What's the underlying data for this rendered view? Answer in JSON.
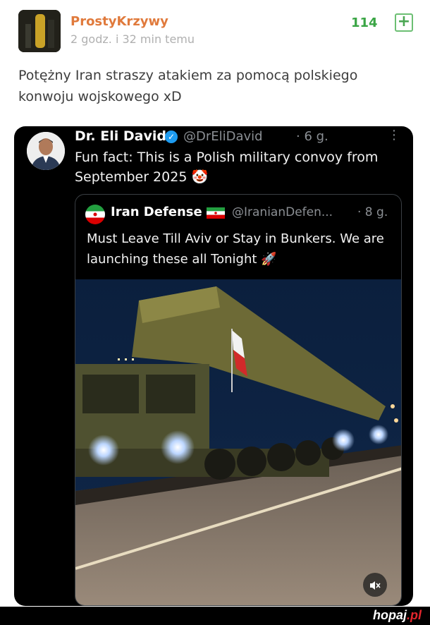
{
  "post": {
    "author": "ProstyKrzywy",
    "time": "2 godz. i 32 min temu",
    "score": "114",
    "plus": "+",
    "text": "Potężny Iran straszy atakiem za pomocą polskiego konwoju wojskowego xD"
  },
  "tweet": {
    "name": "Dr. Eli David",
    "handle": "@DrEliDavid",
    "time": "· 6 g.",
    "more": "⋮",
    "text": "Fun fact: This is a Polish military convoy from September 2025 🤡",
    "quote": {
      "name": "Iran Defense",
      "handle": "@IranianDefen...",
      "time": "· 8 g.",
      "text": "Must Leave Till Aviv or Stay in Bunkers. We are launching these all Tonight 🚀"
    },
    "mute_icon": "mute-speaker-icon"
  },
  "footer": {
    "brand_main": "hopaj",
    "brand_dot": ".pl"
  }
}
